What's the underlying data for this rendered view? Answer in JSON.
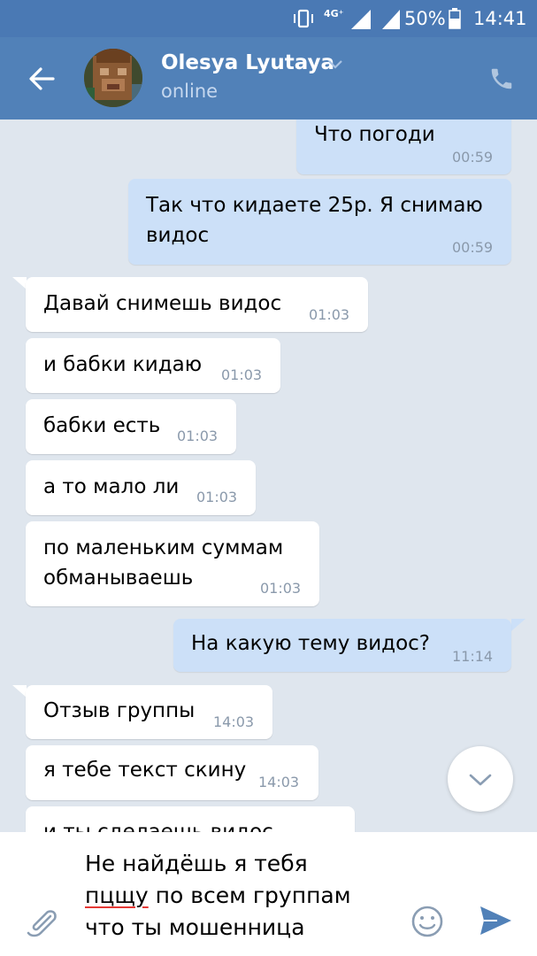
{
  "status_bar": {
    "network": "4G⁺",
    "network2": "4G⁺",
    "battery_percent": "50%",
    "time": "14:41"
  },
  "header": {
    "contact_name": "Olesya Lyutaya",
    "status": "online"
  },
  "messages": [
    {
      "direction": "out",
      "text": "Что погоди",
      "time": "00:59"
    },
    {
      "direction": "out",
      "text": "Так что кидаете 25р. Я снимаю\nвидос",
      "time": "00:59"
    },
    {
      "direction": "in",
      "text": "Давай снимешь видос",
      "time": "01:03"
    },
    {
      "direction": "in",
      "text": "и бабки кидаю",
      "time": "01:03"
    },
    {
      "direction": "in",
      "text": "бабки есть",
      "time": "01:03"
    },
    {
      "direction": "in",
      "text": "а то мало ли",
      "time": "01:03"
    },
    {
      "direction": "in",
      "text": "по маленьким суммам\nобманываешь",
      "time": "01:03"
    },
    {
      "direction": "out",
      "text": "На какую тему видос?",
      "time": "11:14"
    },
    {
      "direction": "in",
      "text": "Отзыв группы",
      "time": "14:03"
    },
    {
      "direction": "in",
      "text": "я тебе текст скину",
      "time": "14:03"
    },
    {
      "direction": "in",
      "text": "и ты сделаешь видос",
      "time": ""
    }
  ],
  "composer": {
    "line1": "Не найдёшь я тебя",
    "line2_misspelled": "пцщу",
    "line2_rest": " по всем группам",
    "line3": "что ты мошенница"
  },
  "colors": {
    "header": "#5181b8",
    "status_bar": "#4a79b4",
    "chat_background": "#dfe6ee",
    "incoming_bubble": "#ffffff",
    "outgoing_bubble": "#cce0f8",
    "send_icon": "#5181b8"
  },
  "icons": [
    "vibrate-icon",
    "signal-icon",
    "battery-icon",
    "back-arrow-icon",
    "chevron-down-icon",
    "phone-icon",
    "scroll-down-icon",
    "paperclip-icon",
    "emoji-icon",
    "send-icon"
  ]
}
